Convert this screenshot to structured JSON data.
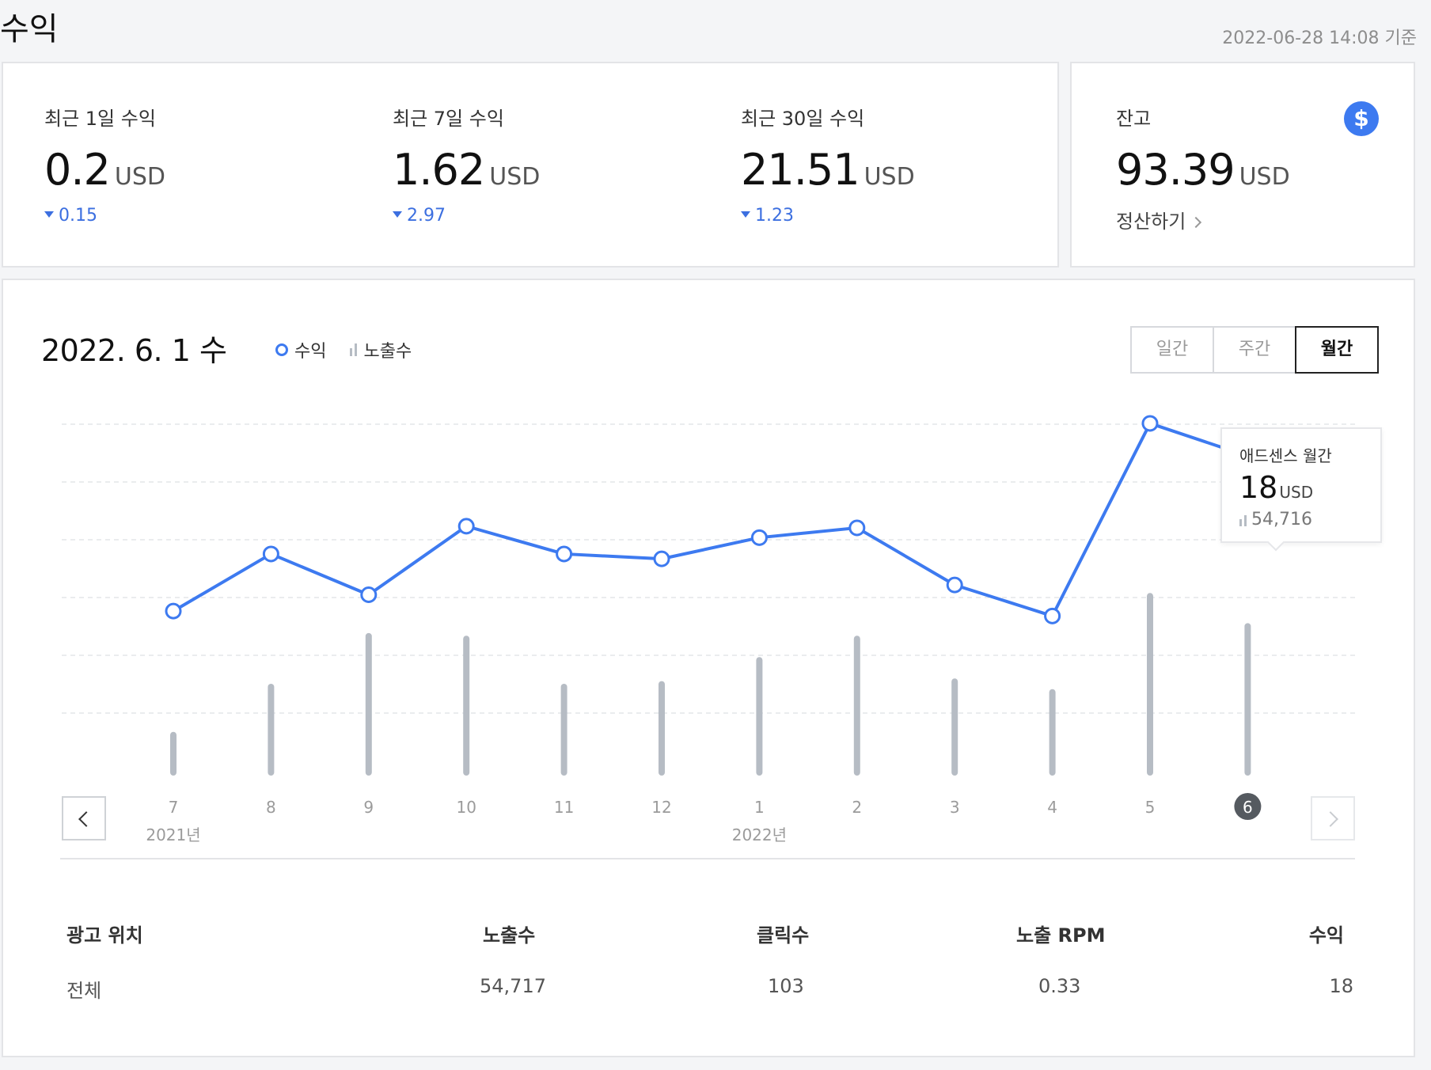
{
  "header": {
    "title": "수익",
    "updated_at": "2022-06-28 14:08 기준"
  },
  "summary": [
    {
      "label": "최근 1일 수익",
      "value": "0.2",
      "unit": "USD",
      "change": "0.15"
    },
    {
      "label": "최근 7일 수익",
      "value": "1.62",
      "unit": "USD",
      "change": "2.97"
    },
    {
      "label": "최근 30일 수익",
      "value": "21.51",
      "unit": "USD",
      "change": "1.23"
    }
  ],
  "balance": {
    "label": "잔고",
    "value": "93.39",
    "unit": "USD",
    "action": "정산하기",
    "icon": "dollar-icon"
  },
  "chart_panel": {
    "date": "2022. 6. 1 수",
    "legend": {
      "revenue": "수익",
      "impressions": "노출수"
    },
    "tabs": [
      {
        "label": "일간",
        "active": false
      },
      {
        "label": "주간",
        "active": false
      },
      {
        "label": "월간",
        "active": true
      }
    ],
    "selected_tick": "6",
    "year_labels": [
      {
        "label": "2021년",
        "at_index": 0
      },
      {
        "label": "2022년",
        "at_index": 6
      }
    ],
    "tooltip": {
      "title": "애드센스 월간",
      "value": "18",
      "unit": "USD",
      "impressions": "54,716"
    }
  },
  "chart_data": {
    "type": "line",
    "categories": [
      "7",
      "8",
      "9",
      "10",
      "11",
      "12",
      "1",
      "2",
      "3",
      "4",
      "5",
      "6"
    ],
    "series": [
      {
        "name": "수익",
        "type": "line",
        "values": [
          8.5,
          12.0,
          9.5,
          13.7,
          12.0,
          11.7,
          13.0,
          13.6,
          10.1,
          8.2,
          20.0,
          18.0
        ]
      },
      {
        "name": "노출수",
        "type": "bar",
        "values": [
          14000,
          32000,
          51000,
          50000,
          32000,
          33000,
          42000,
          50000,
          34000,
          30000,
          66000,
          54716
        ]
      }
    ],
    "grid": true,
    "legend_position": "top-left"
  },
  "table": {
    "headers": [
      "광고 위치",
      "노출수",
      "클릭수",
      "노출 RPM",
      "수익"
    ],
    "rows": [
      [
        "전체",
        "54,717",
        "103",
        "0.33",
        "18"
      ]
    ]
  },
  "colors": {
    "accent": "#3d7af0",
    "change": "#3c6fe0",
    "bar": "#b6bcc4",
    "selected_tick_bg": "#555a60"
  }
}
